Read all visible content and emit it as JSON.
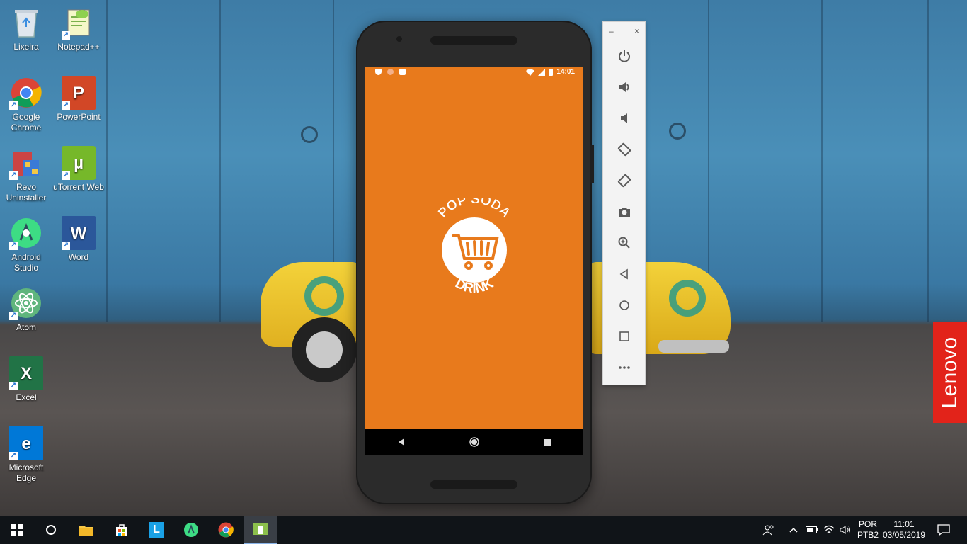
{
  "desktop": {
    "icons": [
      {
        "label": "Lixeira",
        "icon": "recycle-bin-icon"
      },
      {
        "label": "Notepad++",
        "icon": "notepad-plus-plus-icon"
      },
      {
        "label": "Google Chrome",
        "icon": "chrome-icon"
      },
      {
        "label": "PowerPoint",
        "icon": "powerpoint-icon"
      },
      {
        "label": "Revo Uninstaller",
        "icon": "revo-uninstaller-icon"
      },
      {
        "label": "uTorrent Web",
        "icon": "utorrent-icon"
      },
      {
        "label": "Android Studio",
        "icon": "android-studio-icon"
      },
      {
        "label": "Word",
        "icon": "word-icon"
      },
      {
        "label": "Atom",
        "icon": "atom-icon"
      },
      {
        "label": "Excel",
        "icon": "excel-icon"
      },
      {
        "label": "Microsoft Edge",
        "icon": "edge-icon"
      }
    ]
  },
  "phone": {
    "status_time": "14:01",
    "screen_color": "#e87a1c",
    "logo": {
      "top_text": "POP'SODA",
      "bottom_text": "DRINK"
    }
  },
  "emulator_toolbar": {
    "minimize": "–",
    "close": "×",
    "tools": [
      "power-icon",
      "volume-up-icon",
      "volume-down-icon",
      "rotate-left-icon",
      "rotate-right-icon",
      "camera-icon",
      "zoom-icon",
      "back-icon",
      "home-icon",
      "overview-icon",
      "more-icon"
    ]
  },
  "brand_tag": "Lenovo",
  "taskbar": {
    "language": "POR",
    "layout": "PTB2",
    "time": "11:01",
    "date": "03/05/2019"
  }
}
